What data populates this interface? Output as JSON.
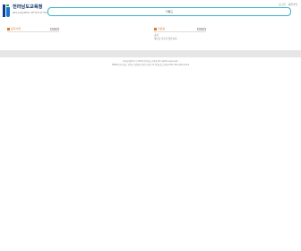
{
  "logo": {
    "title": "전라남도교육청",
    "subtitle": "JEOLLANAMDO OFFICE OF EDUCATION"
  },
  "search": {
    "value": "키워드",
    "placeholder": ""
  },
  "utility": {
    "links": [
      "로그인",
      "회원가입"
    ]
  },
  "panels": {
    "left": {
      "title": "공지사항",
      "more": "more",
      "items": []
    },
    "right": {
      "title": "자료실",
      "more": "more",
      "items": [
        "공지",
        "새로운 자료가 없습니다."
      ]
    }
  },
  "footer": {
    "line1": "Copyright (c) 2019 전라남도교육청 All rights reserved.",
    "line2": "58564 전라남도 무안군 삼향읍 어진누리길 10 전라남도교육청 TEL 061-260-0114"
  },
  "colors": {
    "accent": "#38b5c6",
    "panel_title": "#e0752f",
    "brand": "#0a3f8f"
  }
}
